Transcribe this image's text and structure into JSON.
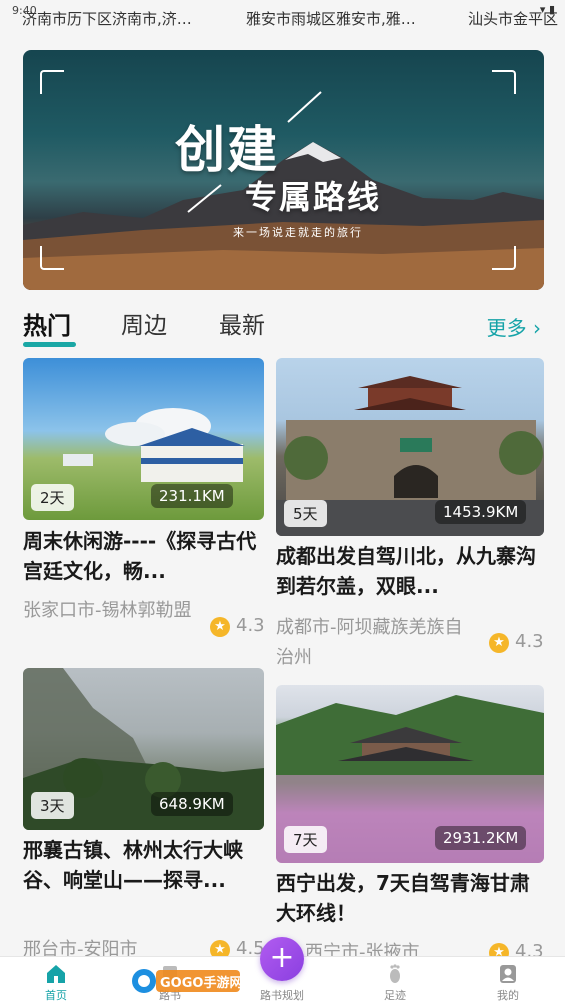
{
  "status": {
    "time": "9:40"
  },
  "ticker": [
    "济南市历下区济南市,济…",
    "雅安市雨城区雅安市,雅…",
    "汕头市金平区"
  ],
  "banner": {
    "title": "创建",
    "subtitle": "专属路线",
    "tagline": "来一场说走就走的旅行"
  },
  "tabs": [
    {
      "label": "热门",
      "active": true
    },
    {
      "label": "周边",
      "active": false
    },
    {
      "label": "最新",
      "active": false
    }
  ],
  "more_label": "更多",
  "cards": [
    {
      "days": "2天",
      "distance": "231.1KM",
      "title": "周末休闲游----《探寻古代宫廷文化，畅...",
      "location": "张家口市-锡林郭勒盟",
      "rating": "4.3"
    },
    {
      "days": "5天",
      "distance": "1453.9KM",
      "title": "成都出发自驾川北，从九寨沟到若尔盖，双眼...",
      "location": "成都市-阿坝藏族羌族自治州",
      "rating": "4.3"
    },
    {
      "days": "3天",
      "distance": "648.9KM",
      "title": "邢襄古镇、林州太行大峡谷、响堂山——探寻...",
      "location": "邢台市-安阳市",
      "rating": "4.5"
    },
    {
      "days": "7天",
      "distance": "2931.2KM",
      "title": "西宁出发，7天自驾青海甘肃大环线！",
      "location": "西宁市-张掖市",
      "rating": "4.3"
    }
  ],
  "watermark": "GOGO手游网",
  "nav": [
    {
      "label": "首页",
      "icon": "home-icon",
      "active": true
    },
    {
      "label": "路书",
      "icon": "book-icon",
      "active": false
    },
    {
      "label": "路书规划",
      "icon": "plus-icon",
      "active": false
    },
    {
      "label": "足迹",
      "icon": "footprint-icon",
      "active": false
    },
    {
      "label": "我的",
      "icon": "user-icon",
      "active": false
    }
  ],
  "colors": {
    "accent": "#16a3a8",
    "star": "#f5b629",
    "fab": "#9b4de8"
  }
}
